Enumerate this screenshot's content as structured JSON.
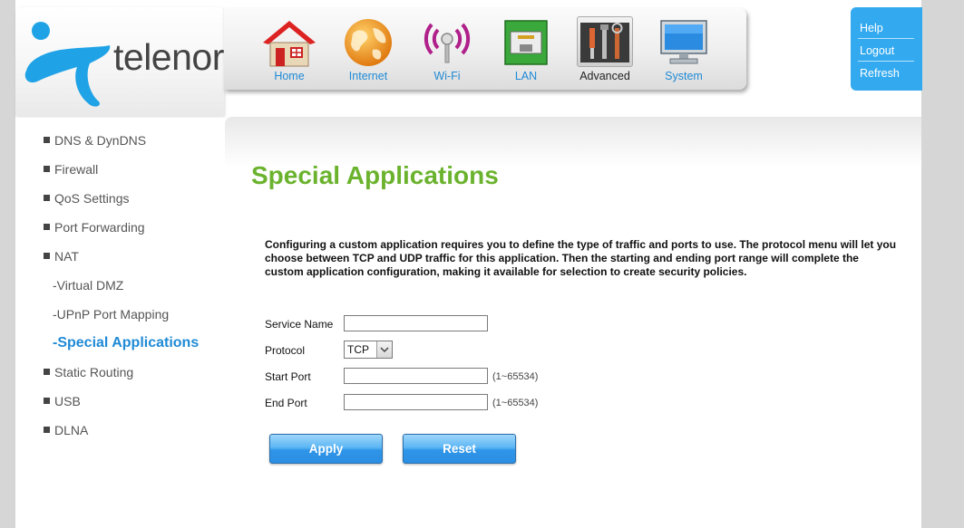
{
  "brand": {
    "name": "telenor",
    "color": "#1fa3e6"
  },
  "nav": [
    {
      "label": "Home",
      "icon": "house-icon"
    },
    {
      "label": "Internet",
      "icon": "globe-icon"
    },
    {
      "label": "Wi-Fi",
      "icon": "wifi-icon"
    },
    {
      "label": "LAN",
      "icon": "lan-port-icon"
    },
    {
      "label": "Advanced",
      "icon": "tools-icon",
      "active": true
    },
    {
      "label": "System",
      "icon": "monitor-icon"
    }
  ],
  "help_links": {
    "help": "Help",
    "logout": "Logout",
    "refresh": "Refresh"
  },
  "sidebar": {
    "items": [
      {
        "label": "DNS & DynDNS"
      },
      {
        "label": "Firewall"
      },
      {
        "label": "QoS Settings"
      },
      {
        "label": "Port Forwarding"
      },
      {
        "label": "NAT"
      },
      {
        "label": "-Virtual DMZ"
      },
      {
        "label": "-UPnP Port Mapping"
      },
      {
        "label": "-Special Applications"
      },
      {
        "label": "Static Routing"
      },
      {
        "label": "USB"
      },
      {
        "label": "DLNA"
      }
    ]
  },
  "main": {
    "title": "Special Applications",
    "description": "Configuring a custom application requires you to define the type of traffic and ports to use. The protocol menu will let you choose between TCP and UDP traffic for this application. Then the starting and ending port range will complete the custom application configuration, making it available for selection to create security policies.",
    "form": {
      "service_name_label": "Service Name",
      "service_name_value": "",
      "protocol_label": "Protocol",
      "protocol_value": "TCP",
      "start_port_label": "Start Port",
      "start_port_value": "",
      "start_port_hint": "(1~65534)",
      "end_port_label": "End Port",
      "end_port_value": "",
      "end_port_hint": "(1~65534)"
    },
    "buttons": {
      "apply": "Apply",
      "reset": "Reset"
    }
  },
  "colors": {
    "accent_blue": "#1f8ad6",
    "title_green": "#6bb32e",
    "help_bg": "#33aaf0"
  }
}
